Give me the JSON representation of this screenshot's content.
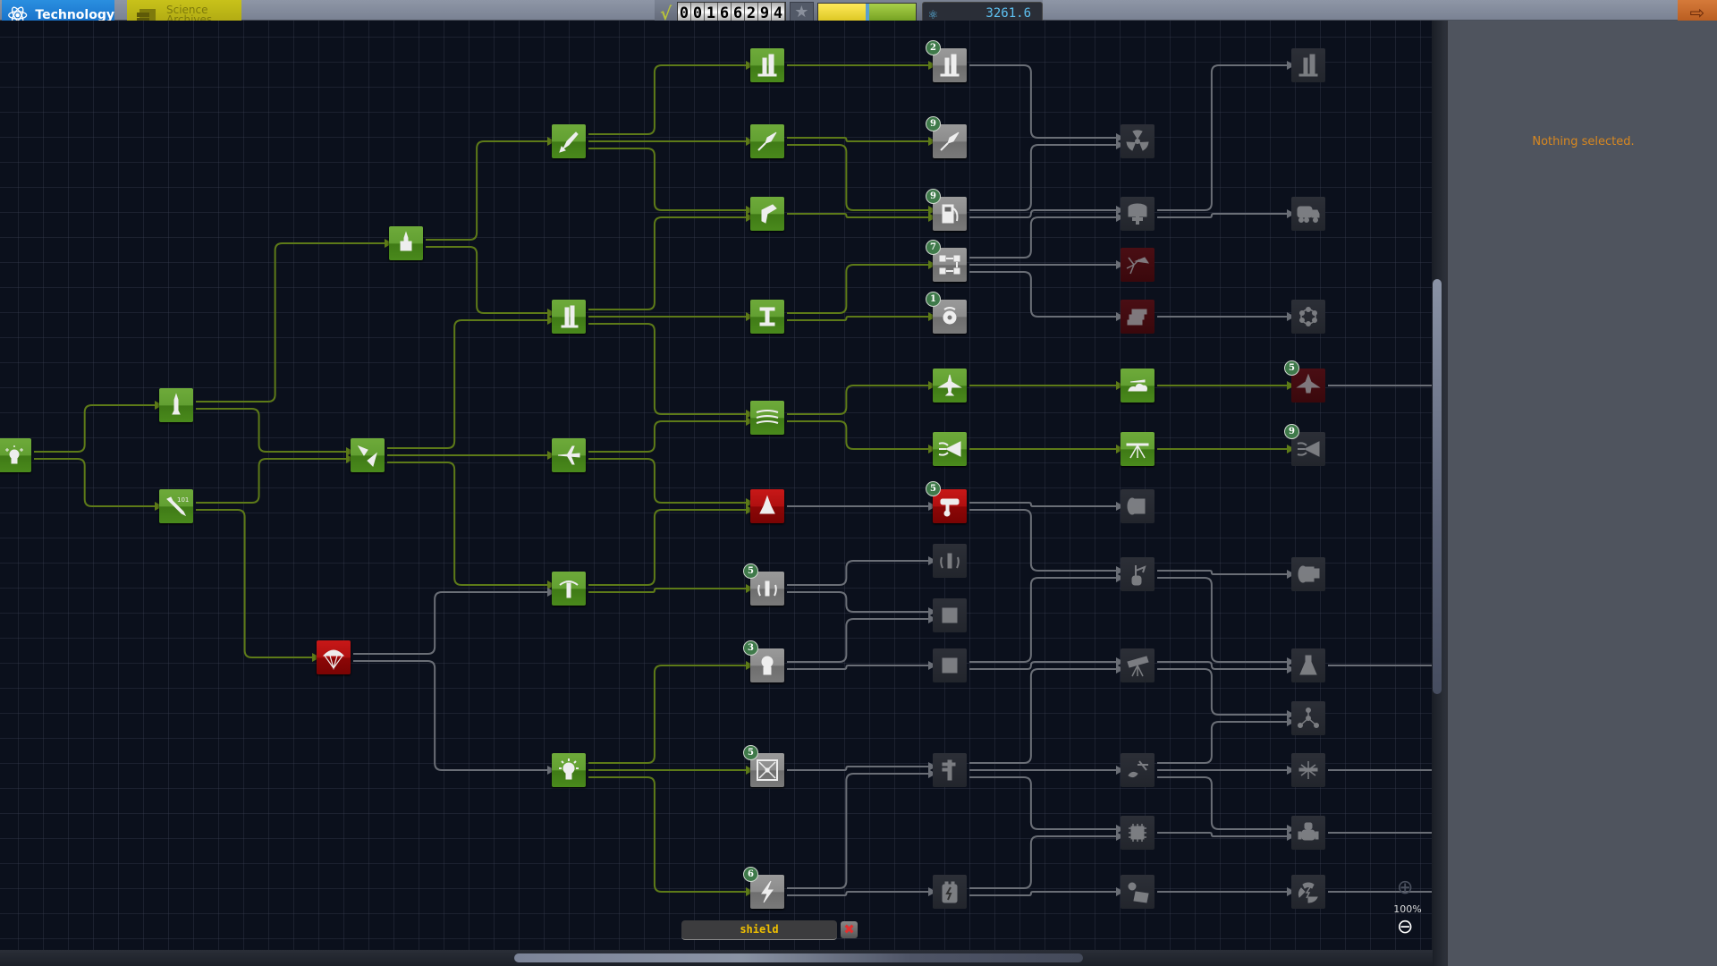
{
  "tabs": {
    "technology": "Technology",
    "archives_line1": "Science",
    "archives_line2": "Archives"
  },
  "funds": {
    "digits": [
      "0",
      "0",
      "1",
      "6",
      "6",
      "2",
      "9",
      "4"
    ],
    "reputation_gauge_position": 0.5,
    "science": "3261.6"
  },
  "side_panel": {
    "message": "Nothing selected."
  },
  "search": {
    "value": "shield",
    "clear_label": "✖"
  },
  "zoom": {
    "level": "100%",
    "zoom_in_icon": "⊕",
    "zoom_out_icon": "⊖"
  },
  "colors": {
    "researched_line": "#5d7a18",
    "locked_line": "#6a6e76",
    "accent_orange": "#d88820"
  },
  "nodes": [
    {
      "id": "start",
      "icon": "astronaut-stars",
      "state": "researched",
      "col": 0,
      "row": "r509"
    },
    {
      "id": "basic-rocketry",
      "icon": "rocket-small",
      "state": "researched",
      "col": 1,
      "row": "r453"
    },
    {
      "id": "engineering101",
      "icon": "wrench-101",
      "state": "researched",
      "col": 1,
      "row": "r566"
    },
    {
      "id": "survivability",
      "icon": "parachute",
      "state": "highlight",
      "col": 2,
      "row": "r735"
    },
    {
      "id": "general-rocketry",
      "icon": "rocket-double",
      "state": "researched",
      "col": 4,
      "row": "r272"
    },
    {
      "id": "stability",
      "icon": "fins",
      "state": "researched",
      "col": 3,
      "row": "r509"
    },
    {
      "id": "advanced-rocketry",
      "icon": "rocket-angled",
      "state": "researched",
      "col": 5,
      "row": "r158"
    },
    {
      "id": "general-construction",
      "icon": "launch-tower",
      "state": "researched",
      "col": 5,
      "row": "r354"
    },
    {
      "id": "aviation",
      "icon": "airplane",
      "state": "researched",
      "col": 5,
      "row": "r509"
    },
    {
      "id": "flight-control",
      "icon": "gyro-stand",
      "state": "researched",
      "col": 5,
      "row": "r658"
    },
    {
      "id": "basic-science",
      "icon": "lightbulb",
      "state": "researched",
      "col": 5,
      "row": "r861"
    },
    {
      "id": "heavy-rocketry",
      "icon": "launch-tower-big",
      "state": "researched",
      "col": 6,
      "row": "r73"
    },
    {
      "id": "propulsion-systems",
      "icon": "rocket-thin",
      "state": "researched",
      "col": 6,
      "row": "r158"
    },
    {
      "id": "fuel-systems",
      "icon": "fuel-nozzle",
      "state": "researched",
      "col": 6,
      "row": "r239"
    },
    {
      "id": "advanced-construction",
      "icon": "girder",
      "state": "researched",
      "col": 6,
      "row": "r354"
    },
    {
      "id": "aerodynamics",
      "icon": "wind-lines",
      "state": "researched",
      "col": 6,
      "row": "r467"
    },
    {
      "id": "landing",
      "icon": "lander-red",
      "state": "highlight",
      "col": 6,
      "row": "r566"
    },
    {
      "id": "advanced-flight-control",
      "icon": "gyro-rocket",
      "state": "available",
      "col": 6,
      "row": "r658",
      "badge": "5"
    },
    {
      "id": "space-exploration",
      "icon": "astronaut",
      "state": "available",
      "col": 6,
      "row": "r744",
      "badge": "3"
    },
    {
      "id": "miniaturization",
      "icon": "compress-box",
      "state": "available",
      "col": 6,
      "row": "r861",
      "badge": "5"
    },
    {
      "id": "electrics",
      "icon": "lightning",
      "state": "available",
      "col": 6,
      "row": "r997",
      "badge": "6"
    },
    {
      "id": "heavier-rocketry",
      "icon": "launch-tower-big",
      "state": "available",
      "col": 7,
      "row": "r73",
      "badge": "2"
    },
    {
      "id": "precision-propulsion",
      "icon": "rocket-thin",
      "state": "available",
      "col": 7,
      "row": "r158",
      "badge": "9"
    },
    {
      "id": "fuel-systems-advanced",
      "icon": "fuel-pump",
      "state": "available",
      "col": 7,
      "row": "r239",
      "badge": "9"
    },
    {
      "id": "specialized-construction",
      "icon": "docking-arrows",
      "state": "available",
      "col": 7,
      "row": "r296",
      "badge": "7"
    },
    {
      "id": "actuators",
      "icon": "wheel-hub",
      "state": "available",
      "col": 7,
      "row": "r354",
      "badge": "1"
    },
    {
      "id": "supersonic-flight",
      "icon": "jet",
      "state": "researched",
      "col": 7,
      "row": "r431"
    },
    {
      "id": "aero-intakes",
      "icon": "intake",
      "state": "researched",
      "col": 7,
      "row": "r502"
    },
    {
      "id": "advanced-landing",
      "icon": "landing-leg",
      "state": "highlight",
      "col": 7,
      "row": "r566",
      "badge": "5"
    },
    {
      "id": "command-modules",
      "icon": "gyro-rocket-alt",
      "state": "locked",
      "col": 7,
      "row": "r627"
    },
    {
      "id": "command-pod",
      "icon": "capsule",
      "state": "locked",
      "col": 7,
      "row": "r688"
    },
    {
      "id": "advanced-exploration",
      "icon": "ladder-astronaut",
      "state": "locked",
      "col": 7,
      "row": "r744"
    },
    {
      "id": "precision-engineering",
      "icon": "caliper",
      "state": "locked",
      "col": 7,
      "row": "r861"
    },
    {
      "id": "advanced-electrics",
      "icon": "battery",
      "state": "locked",
      "col": 7,
      "row": "r997"
    },
    {
      "id": "nuclear-propulsion",
      "icon": "radiation",
      "state": "locked",
      "col": 8,
      "row": "r158"
    },
    {
      "id": "large-volume",
      "icon": "tank-plus",
      "state": "locked",
      "col": 8,
      "row": "r239"
    },
    {
      "id": "advanced-metalworks",
      "icon": "welder",
      "state": "locked-hl",
      "col": 8,
      "row": "r296"
    },
    {
      "id": "composites",
      "icon": "plates",
      "state": "locked-hl",
      "col": 8,
      "row": "r354"
    },
    {
      "id": "high-altitude-flight",
      "icon": "plane-cloud",
      "state": "researched",
      "col": 8,
      "row": "r431"
    },
    {
      "id": "hypersonic-flight",
      "icon": "plane-landing",
      "state": "researched",
      "col": 8,
      "row": "r502"
    },
    {
      "id": "advanced-motors",
      "icon": "motor",
      "state": "locked",
      "col": 8,
      "row": "r566"
    },
    {
      "id": "field-science",
      "icon": "drill-arm",
      "state": "locked",
      "col": 8,
      "row": "r642"
    },
    {
      "id": "advanced-science",
      "icon": "telescope",
      "state": "locked",
      "col": 8,
      "row": "r744"
    },
    {
      "id": "electronics",
      "icon": "dish-antenna",
      "state": "locked",
      "col": 8,
      "row": "r861"
    },
    {
      "id": "advanced-units",
      "icon": "chip",
      "state": "locked",
      "col": 8,
      "row": "r931"
    },
    {
      "id": "high-power-electrics",
      "icon": "solar-panel",
      "state": "locked",
      "col": 8,
      "row": "r997"
    },
    {
      "id": "very-heavy-rocketry",
      "icon": "launch-tower-big",
      "state": "locked",
      "col": 9,
      "row": "r73"
    },
    {
      "id": "fuel-transport",
      "icon": "tanker-truck",
      "state": "locked",
      "col": 9,
      "row": "r239"
    },
    {
      "id": "meta-materials",
      "icon": "molecule-ring",
      "state": "locked",
      "col": 9,
      "row": "r354"
    },
    {
      "id": "heavy-aerodynamics",
      "icon": "shuttle",
      "state": "locked-hl",
      "col": 9,
      "row": "r431",
      "badge": "5"
    },
    {
      "id": "aerospace-tech",
      "icon": "intake",
      "state": "locked",
      "col": 9,
      "row": "r502",
      "badge": "9"
    },
    {
      "id": "heavy-motors",
      "icon": "motor-big",
      "state": "locked",
      "col": 9,
      "row": "r642"
    },
    {
      "id": "scanning-tech",
      "icon": "flask",
      "state": "locked",
      "col": 9,
      "row": "r744"
    },
    {
      "id": "specialized-science",
      "icon": "tripod-nodes",
      "state": "locked",
      "col": 9,
      "row": "r803"
    },
    {
      "id": "experimental-electrics",
      "icon": "satellite-star",
      "state": "locked",
      "col": 9,
      "row": "r861"
    },
    {
      "id": "automation",
      "icon": "robot",
      "state": "locked",
      "col": 9,
      "row": "r931"
    },
    {
      "id": "specialized-electrics",
      "icon": "recycle-bolt",
      "state": "locked",
      "col": 9,
      "row": "r997"
    }
  ]
}
